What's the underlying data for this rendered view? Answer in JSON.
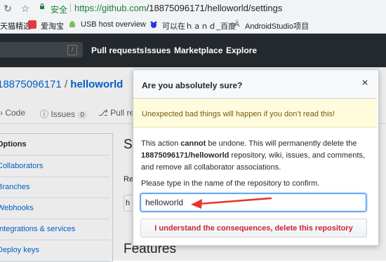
{
  "browser": {
    "secure_label": "安全",
    "url_scheme": "https://",
    "url_host": "github.com",
    "url_path": "/18875096171/helloworld/settings"
  },
  "bookmarks": [
    {
      "label": "天猫精选",
      "icon": "tmall-icon",
      "color": "#e4393c"
    },
    {
      "label": "爱淘宝",
      "icon": "taobao-icon",
      "color": "#ff5000"
    },
    {
      "label": "USB host overview",
      "icon": "android-icon",
      "color": "#78c257"
    },
    {
      "label": "可以在ｈａｎｄ_百度",
      "icon": "baidu-icon",
      "color": "#2932e1"
    },
    {
      "label": "AndroidStudio项目",
      "icon": "androidstudio-icon",
      "color": "#555555"
    }
  ],
  "github_nav": [
    "Pull requests",
    "Issues",
    "Marketplace",
    "Explore"
  ],
  "repo": {
    "owner": "18875096171",
    "separator": "/",
    "name": "helloworld"
  },
  "tabs": {
    "code": "Code",
    "issues": "Issues",
    "issues_count": "0",
    "pull_requests": "Pull requ"
  },
  "sidebar": [
    "Options",
    "Collaborators",
    "Branches",
    "Webhooks",
    "Integrations & services",
    "Deploy keys"
  ],
  "main": {
    "settings_heading_partial": "Se",
    "repo_name_label_partial": "Re",
    "features_heading": "Features"
  },
  "modal": {
    "title": "Are you absolutely sure?",
    "close_glyph": "×",
    "warning": "Unexpected bad things will happen if you don’t read this!",
    "body_pre": "This action ",
    "body_bold": "cannot",
    "body_mid": " be undone. This will permanently delete the ",
    "body_repo": "18875096171/helloworld",
    "body_post": " repository, wiki, issues, and comments, and remove all collaborator associations.",
    "confirm_prompt": "Please type in the name of the repository to confirm.",
    "input_value": "helloworld",
    "delete_button": "I understand the consequences, delete this repository"
  },
  "colors": {
    "danger": "#cb2431",
    "annotation_arrow": "#e8362b",
    "link": "#0366d6"
  }
}
